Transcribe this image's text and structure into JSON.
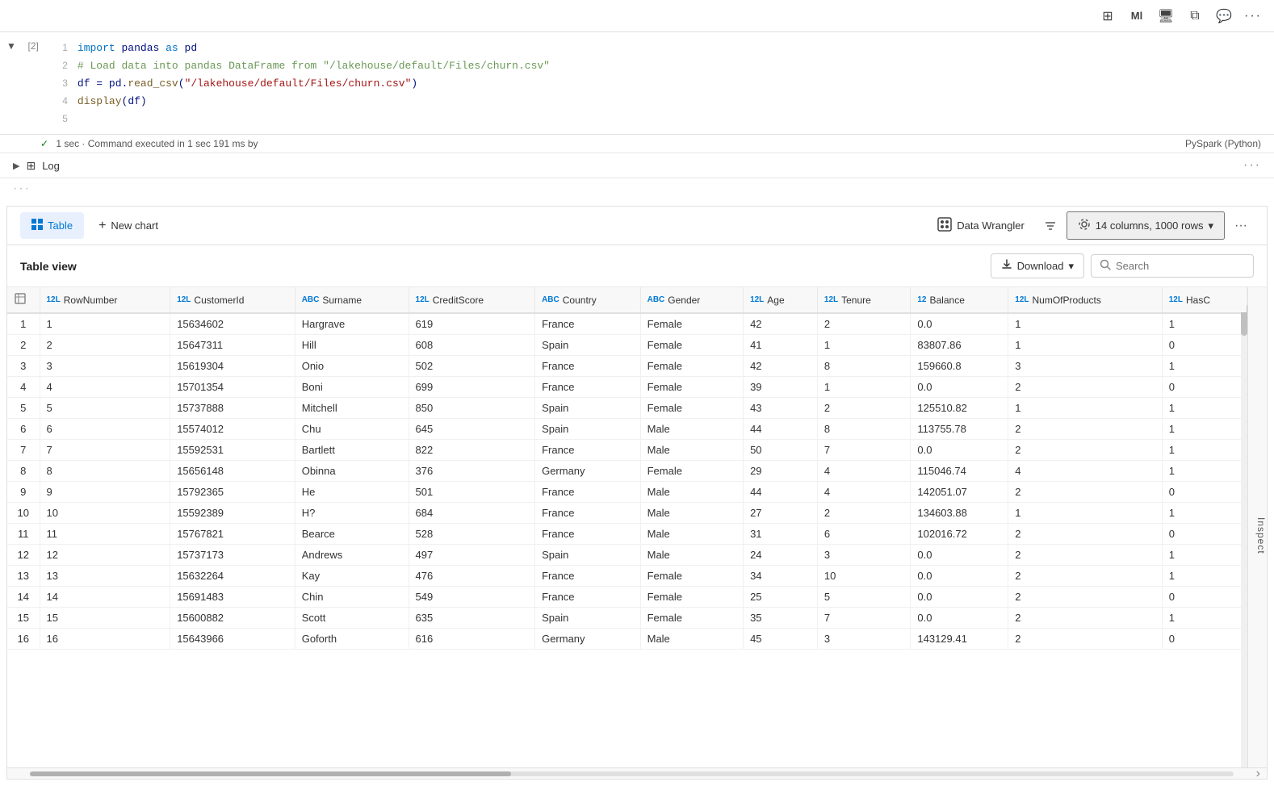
{
  "toolbar": {
    "icons": [
      "⊞",
      "Ml",
      "⬜",
      "⬜",
      "⬜",
      "···"
    ]
  },
  "cell": {
    "number": "[2]",
    "lines": [
      {
        "num": "1",
        "tokens": [
          {
            "t": "kw",
            "v": "import"
          },
          {
            "t": "id",
            "v": " pandas "
          },
          {
            "t": "kw",
            "v": "as"
          },
          {
            "t": "id",
            "v": " pd"
          }
        ]
      },
      {
        "num": "2",
        "tokens": [
          {
            "t": "cm",
            "v": "# Load data into pandas DataFrame from \"/lakehouse/default/Files/churn.csv\""
          }
        ]
      },
      {
        "num": "3",
        "tokens": [
          {
            "t": "id",
            "v": "df"
          },
          {
            "t": "id",
            "v": " = "
          },
          {
            "t": "id",
            "v": "pd"
          },
          {
            "t": "id",
            "v": "."
          },
          {
            "t": "fn",
            "v": "read_csv"
          },
          {
            "t": "id",
            "v": "("
          },
          {
            "t": "str",
            "v": "\"/lakehouse/default/Files/churn.csv\""
          },
          {
            "t": "id",
            "v": ")"
          }
        ]
      },
      {
        "num": "4",
        "tokens": [
          {
            "t": "fn",
            "v": "display"
          },
          {
            "t": "id",
            "v": "("
          },
          {
            "t": "id",
            "v": "df"
          },
          {
            "t": "id",
            "v": ")"
          }
        ]
      },
      {
        "num": "5",
        "tokens": [
          {
            "t": "id",
            "v": ""
          }
        ]
      }
    ]
  },
  "exec_status": {
    "check": "✓",
    "text": "1 sec · Command executed in 1 sec 191 ms by",
    "label": "PySpark (Python)"
  },
  "log": {
    "label": "Log"
  },
  "panel": {
    "table_tab": "Table",
    "new_chart": "New chart",
    "data_wrangler": "Data Wrangler",
    "columns_info": "14 columns, 1000 rows",
    "table_view_title": "Table view",
    "download_label": "Download",
    "search_placeholder": "Search",
    "inspect_label": "Inspect"
  },
  "table": {
    "columns": [
      {
        "type": "12L",
        "name": "RowNumber"
      },
      {
        "type": "12L",
        "name": "CustomerId"
      },
      {
        "type": "ABC",
        "name": "Surname"
      },
      {
        "type": "12L",
        "name": "CreditScore"
      },
      {
        "type": "ABC",
        "name": "Country"
      },
      {
        "type": "ABC",
        "name": "Gender"
      },
      {
        "type": "12L",
        "name": "Age"
      },
      {
        "type": "12L",
        "name": "Tenure"
      },
      {
        "type": "12",
        "name": "Balance"
      },
      {
        "type": "12L",
        "name": "NumOfProducts"
      },
      {
        "type": "12L",
        "name": "HasC"
      }
    ],
    "rows": [
      [
        1,
        1,
        15634602,
        "Hargrave",
        619,
        "France",
        "Female",
        42,
        2,
        "0.0",
        1,
        1
      ],
      [
        2,
        2,
        15647311,
        "Hill",
        608,
        "Spain",
        "Female",
        41,
        1,
        "83807.86",
        1,
        0
      ],
      [
        3,
        3,
        15619304,
        "Onio",
        502,
        "France",
        "Female",
        42,
        8,
        "159660.8",
        3,
        1
      ],
      [
        4,
        4,
        15701354,
        "Boni",
        699,
        "France",
        "Female",
        39,
        1,
        "0.0",
        2,
        0
      ],
      [
        5,
        5,
        15737888,
        "Mitchell",
        850,
        "Spain",
        "Female",
        43,
        2,
        "125510.82",
        1,
        1
      ],
      [
        6,
        6,
        15574012,
        "Chu",
        645,
        "Spain",
        "Male",
        44,
        8,
        "113755.78",
        2,
        1
      ],
      [
        7,
        7,
        15592531,
        "Bartlett",
        822,
        "France",
        "Male",
        50,
        7,
        "0.0",
        2,
        1
      ],
      [
        8,
        8,
        15656148,
        "Obinna",
        376,
        "Germany",
        "Female",
        29,
        4,
        "115046.74",
        4,
        1
      ],
      [
        9,
        9,
        15792365,
        "He",
        501,
        "France",
        "Male",
        44,
        4,
        "142051.07",
        2,
        0
      ],
      [
        10,
        10,
        15592389,
        "H?",
        684,
        "France",
        "Male",
        27,
        2,
        "134603.88",
        1,
        1
      ],
      [
        11,
        11,
        15767821,
        "Bearce",
        528,
        "France",
        "Male",
        31,
        6,
        "102016.72",
        2,
        0
      ],
      [
        12,
        12,
        15737173,
        "Andrews",
        497,
        "Spain",
        "Male",
        24,
        3,
        "0.0",
        2,
        1
      ],
      [
        13,
        13,
        15632264,
        "Kay",
        476,
        "France",
        "Female",
        34,
        10,
        "0.0",
        2,
        1
      ],
      [
        14,
        14,
        15691483,
        "Chin",
        549,
        "France",
        "Female",
        25,
        5,
        "0.0",
        2,
        0
      ],
      [
        15,
        15,
        15600882,
        "Scott",
        635,
        "Spain",
        "Female",
        35,
        7,
        "0.0",
        2,
        1
      ],
      [
        16,
        16,
        15643966,
        "Goforth",
        616,
        "Germany",
        "Male",
        45,
        3,
        "143129.41",
        2,
        0
      ]
    ]
  }
}
